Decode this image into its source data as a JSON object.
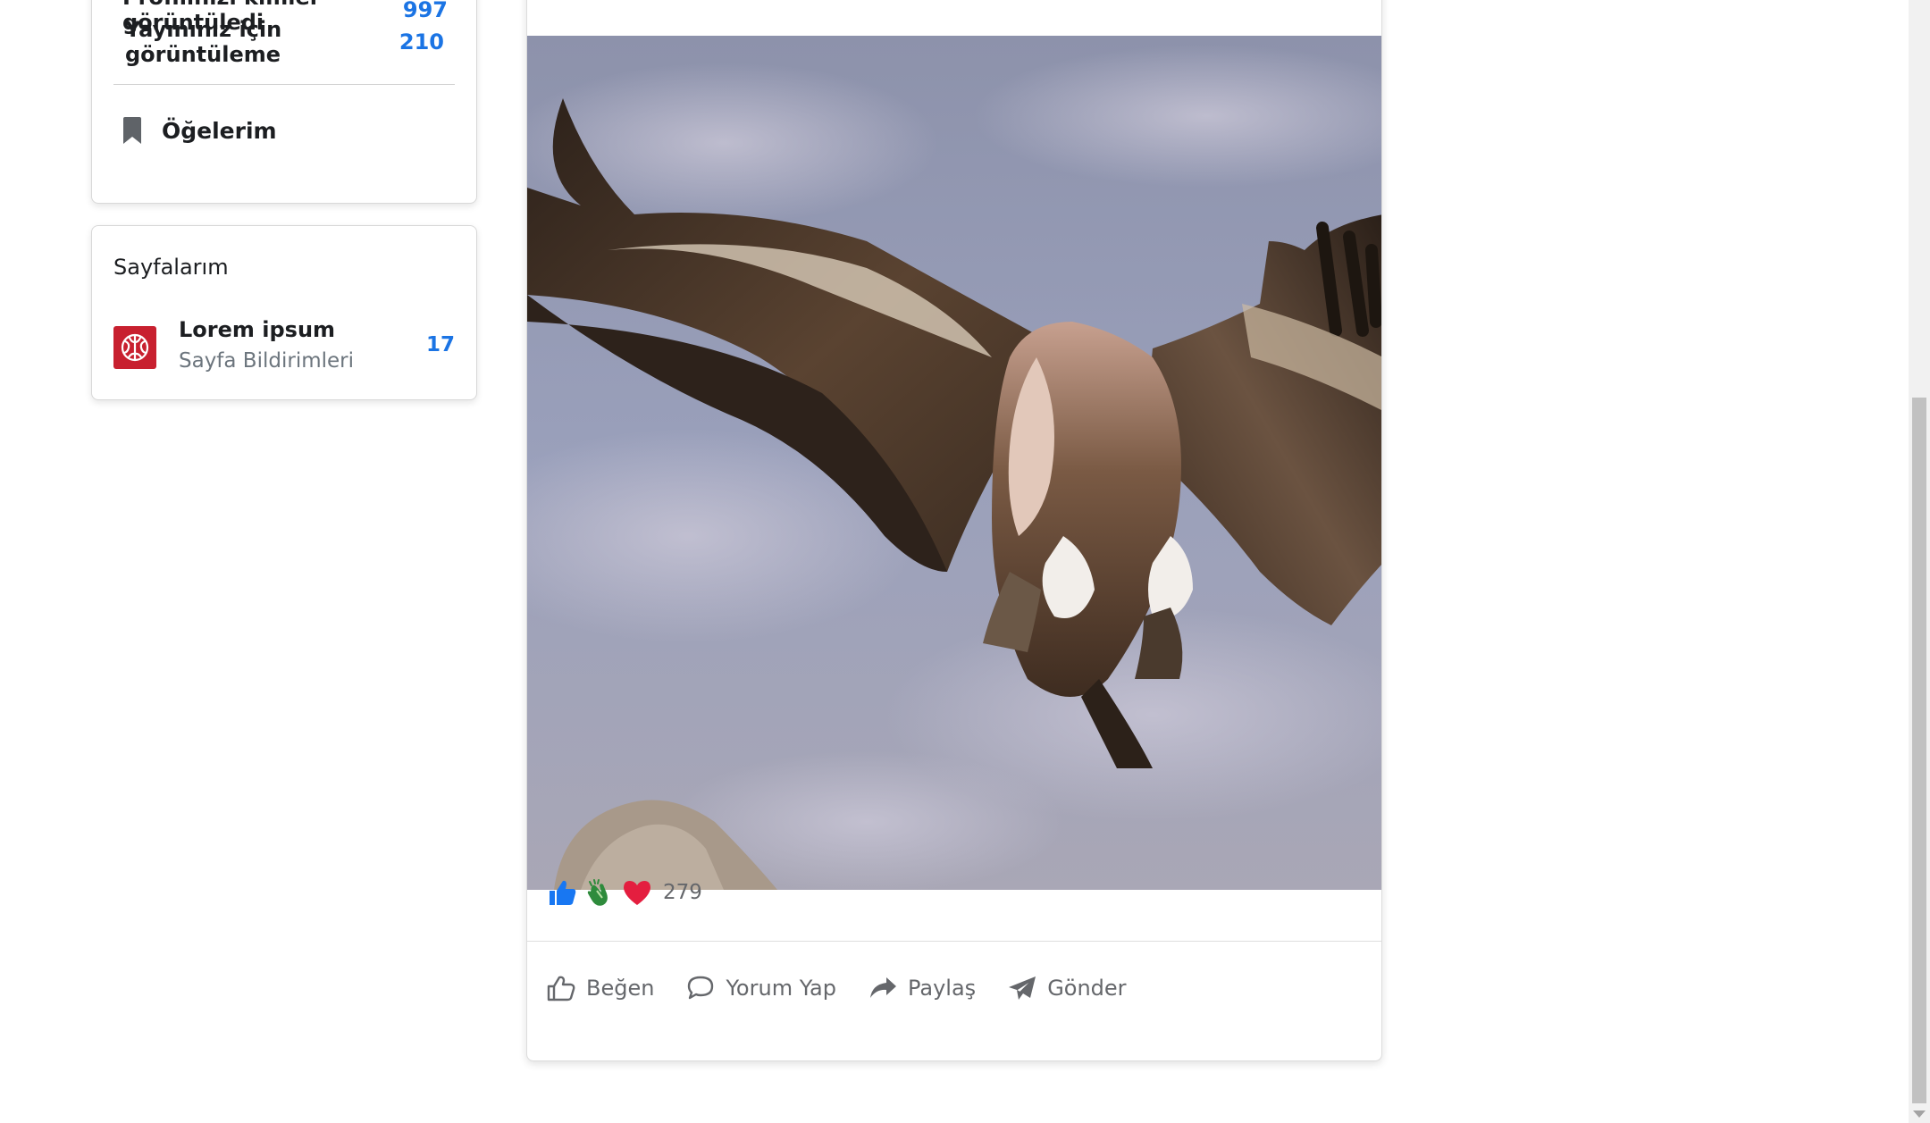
{
  "sidebar": {
    "stats": [
      {
        "label": "Profilinizi kimler görüntüledi",
        "value": "997"
      },
      {
        "label": "Yayınınız için görüntüleme",
        "value": "210"
      }
    ],
    "saved_items_label": "Öğelerim",
    "pages": {
      "title": "Sayfalarım",
      "items": [
        {
          "name": "Lorem ipsum",
          "subtitle": "Sayfa Bildirimleri",
          "count": "17"
        }
      ]
    }
  },
  "post": {
    "image_alt": "vulture",
    "reactions": {
      "icons": [
        "like-icon",
        "clap-icon",
        "heart-icon"
      ],
      "count": "279"
    },
    "actions": [
      {
        "label": "Beğen",
        "icon": "thumbs-up-outline-icon"
      },
      {
        "label": "Yorum Yap",
        "icon": "comment-icon"
      },
      {
        "label": "Paylaş",
        "icon": "share-arrow-icon"
      },
      {
        "label": "Gönder",
        "icon": "paper-plane-icon"
      }
    ]
  },
  "colors": {
    "accent": "#1b74e4",
    "muted": "#65676b",
    "page_logo": "#c8202f",
    "heart": "#e41e3f"
  }
}
